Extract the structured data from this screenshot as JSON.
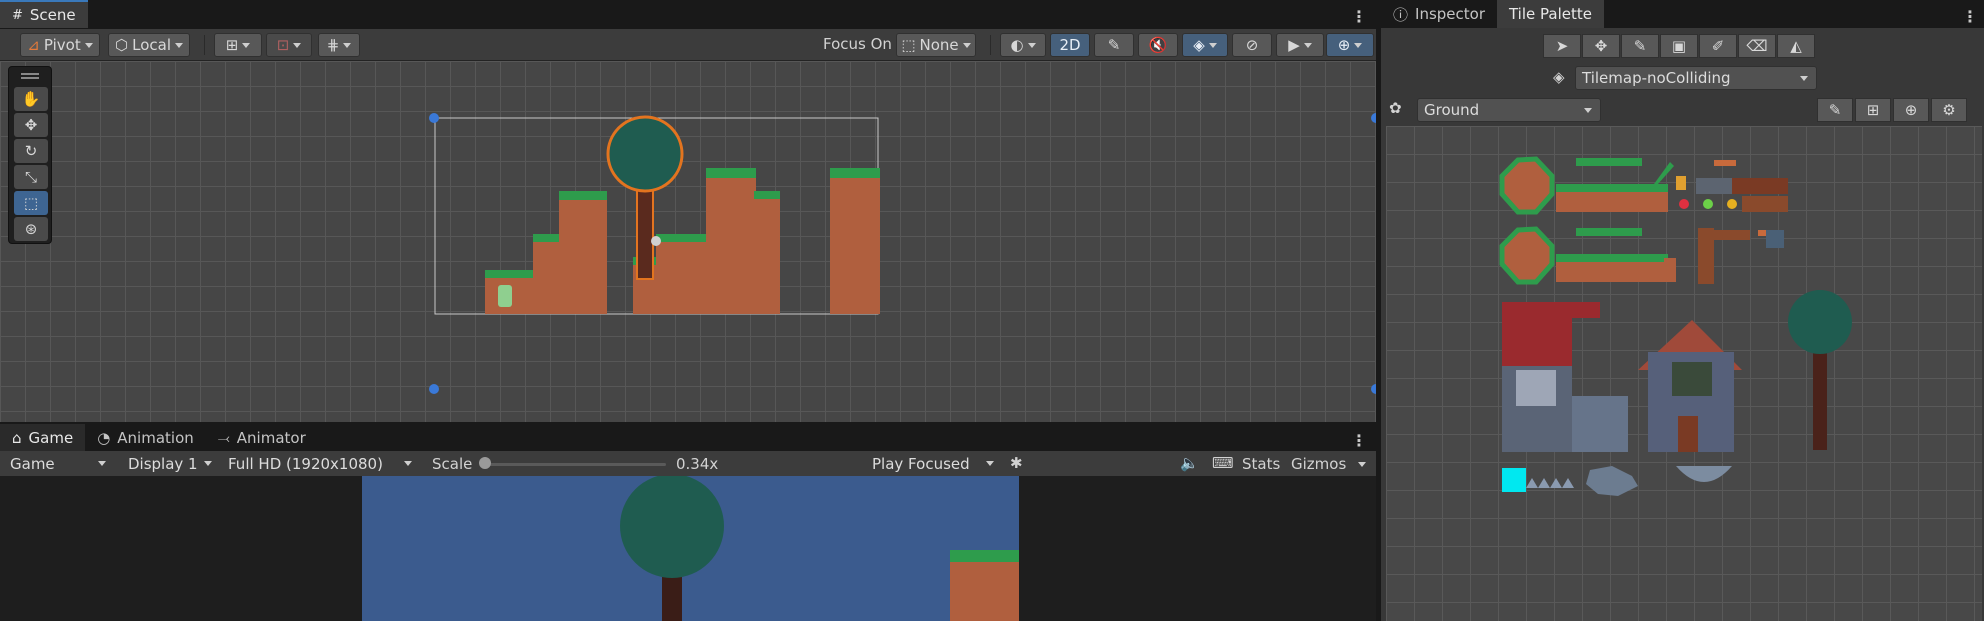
{
  "scene_panel": {
    "tab_label": "Scene",
    "pivot_label": "Pivot",
    "local_label": "Local",
    "focus_on_label": "Focus On",
    "focus_value": "None",
    "mode_2d_label": "2D"
  },
  "bottom_panel": {
    "tabs": [
      {
        "label": "Game"
      },
      {
        "label": "Animation"
      },
      {
        "label": "Animator"
      }
    ],
    "game_select": "Game",
    "display_select": "Display 1",
    "resolution_select": "Full HD (1920x1080)",
    "scale_label": "Scale",
    "scale_value": "0.34x",
    "scale_fraction": 0.0,
    "play_mode_select": "Play Focused",
    "stats_label": "Stats",
    "gizmos_label": "Gizmos"
  },
  "right_panel": {
    "tabs": [
      {
        "label": "Inspector"
      },
      {
        "label": "Tile Palette"
      }
    ],
    "tilemap_select": "Tilemap-noColliding",
    "palette_select": "Ground"
  },
  "colors": {
    "accent": "#3a79bb",
    "grass": "#2e9c4c",
    "dirt": "#b05f3e",
    "tree_leaves": "#1f5c50",
    "sky": "#3b5b8e"
  }
}
